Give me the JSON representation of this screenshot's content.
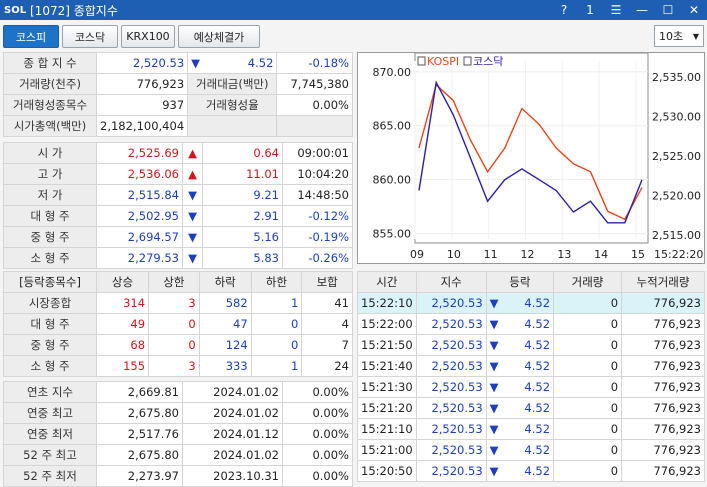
{
  "titlebar": {
    "logo": "SOL",
    "title": "[1072] 종합지수",
    "help": "?",
    "page": "1",
    "menu": "☰",
    "minimize": "—",
    "maximize": "☐",
    "close": "✕"
  },
  "toolbar": {
    "tabs": [
      "코스피",
      "코스닥",
      "KRX100",
      "예상체결가"
    ],
    "interval": "10초"
  },
  "summary": [
    [
      "종 합 지 수",
      "2,520.53",
      "▼",
      "4.52",
      "-0.18%"
    ],
    [
      "거래량(천주)",
      "776,923",
      "거래대금(백만)",
      "7,745,380"
    ],
    [
      "거래형성종목수",
      "937",
      "거래형성율",
      "0.00%"
    ],
    [
      "시가총액(백만)",
      "2,182,100,404"
    ]
  ],
  "prices": [
    {
      "label": "시    가",
      "value": "2,525.69",
      "dir": "▲",
      "chg": "0.64",
      "extra": "09:00:01",
      "color": "red"
    },
    {
      "label": "고    가",
      "value": "2,536.06",
      "dir": "▲",
      "chg": "11.01",
      "extra": "10:04:20",
      "color": "red"
    },
    {
      "label": "저    가",
      "value": "2,515.84",
      "dir": "▼",
      "chg": "9.21",
      "extra": "14:48:50",
      "color": "blue"
    },
    {
      "label": "대 형 주",
      "value": "2,502.95",
      "dir": "▼",
      "chg": "2.91",
      "extra": "-0.12%",
      "color": "blue"
    },
    {
      "label": "중 형 주",
      "value": "2,694.57",
      "dir": "▼",
      "chg": "5.16",
      "extra": "-0.19%",
      "color": "blue"
    },
    {
      "label": "소 형 주",
      "value": "2,279.53",
      "dir": "▼",
      "chg": "5.83",
      "extra": "-0.26%",
      "color": "blue"
    }
  ],
  "breadth": {
    "headers": [
      "[등락종목수]",
      "상승",
      "상한",
      "하락",
      "하한",
      "보합"
    ],
    "rows": [
      [
        "시장종합",
        "314",
        "3",
        "582",
        "1",
        "41"
      ],
      [
        "대 형 주",
        "49",
        "0",
        "47",
        "0",
        "4"
      ],
      [
        "중 형 주",
        "68",
        "0",
        "124",
        "0",
        "7"
      ],
      [
        "소 형 주",
        "155",
        "3",
        "333",
        "1",
        "24"
      ]
    ]
  },
  "yearly": [
    [
      "연초  지수",
      "2,669.81",
      "2024.01.02",
      "0.00%"
    ],
    [
      "연중  최고",
      "2,675.80",
      "2024.01.02",
      "0.00%"
    ],
    [
      "연중  최저",
      "2,517.76",
      "2024.01.12",
      "0.00%"
    ],
    [
      "52 주 최고",
      "2,675.80",
      "2024.01.02",
      "0.00%"
    ],
    [
      "52 주 최저",
      "2,273.97",
      "2023.10.31",
      "0.00%"
    ]
  ],
  "ticks": {
    "headers": [
      "시간",
      "지수",
      "등락",
      "거래량",
      "누적거래량"
    ],
    "rows": [
      [
        "15:22:10",
        "2,520.53",
        "▼",
        "4.52",
        "0",
        "776,923"
      ],
      [
        "15:22:00",
        "2,520.53",
        "▼",
        "4.52",
        "0",
        "776,923"
      ],
      [
        "15:21:50",
        "2,520.53",
        "▼",
        "4.52",
        "0",
        "776,923"
      ],
      [
        "15:21:40",
        "2,520.53",
        "▼",
        "4.52",
        "0",
        "776,923"
      ],
      [
        "15:21:30",
        "2,520.53",
        "▼",
        "4.52",
        "0",
        "776,923"
      ],
      [
        "15:21:20",
        "2,520.53",
        "▼",
        "4.52",
        "0",
        "776,923"
      ],
      [
        "15:21:10",
        "2,520.53",
        "▼",
        "4.52",
        "0",
        "776,923"
      ],
      [
        "15:21:00",
        "2,520.53",
        "▼",
        "4.52",
        "0",
        "776,923"
      ],
      [
        "15:20:50",
        "2,520.53",
        "▼",
        "4.52",
        "0",
        "776,923"
      ]
    ]
  },
  "chart_data": {
    "type": "line",
    "legend": [
      "KOSPI",
      "코스닥"
    ],
    "left_ticks": [
      "870.00",
      "865.00",
      "860.00",
      "855.00"
    ],
    "right_ticks": [
      "2,535.00",
      "2,530.00",
      "2,525.00",
      "2,520.00",
      "2,515.00"
    ],
    "x_ticks": [
      "09",
      "10",
      "11",
      "12",
      "13",
      "14",
      "15"
    ],
    "last_time": "15:22:20",
    "x": [
      "09:00",
      "09:30",
      "10:00",
      "10:30",
      "11:00",
      "11:30",
      "12:00",
      "12:30",
      "13:00",
      "13:30",
      "14:00",
      "14:30",
      "15:00",
      "15:20"
    ],
    "series": [
      {
        "name": "KOSPI",
        "color": "#e8461b",
        "axis": "right",
        "values": [
          2526,
          2534,
          2532,
          2527,
          2523,
          2526,
          2531,
          2529,
          2526,
          2524,
          2523,
          2518,
          2517,
          2521
        ]
      },
      {
        "name": "코스닥",
        "color": "#2a1fa8",
        "axis": "left",
        "values": [
          859,
          869,
          866,
          862,
          858,
          860,
          861,
          860,
          859,
          857,
          858,
          856,
          856,
          860
        ]
      }
    ],
    "left_range": [
      854.5,
      871
    ],
    "right_range": [
      2514.5,
      2537
    ]
  }
}
